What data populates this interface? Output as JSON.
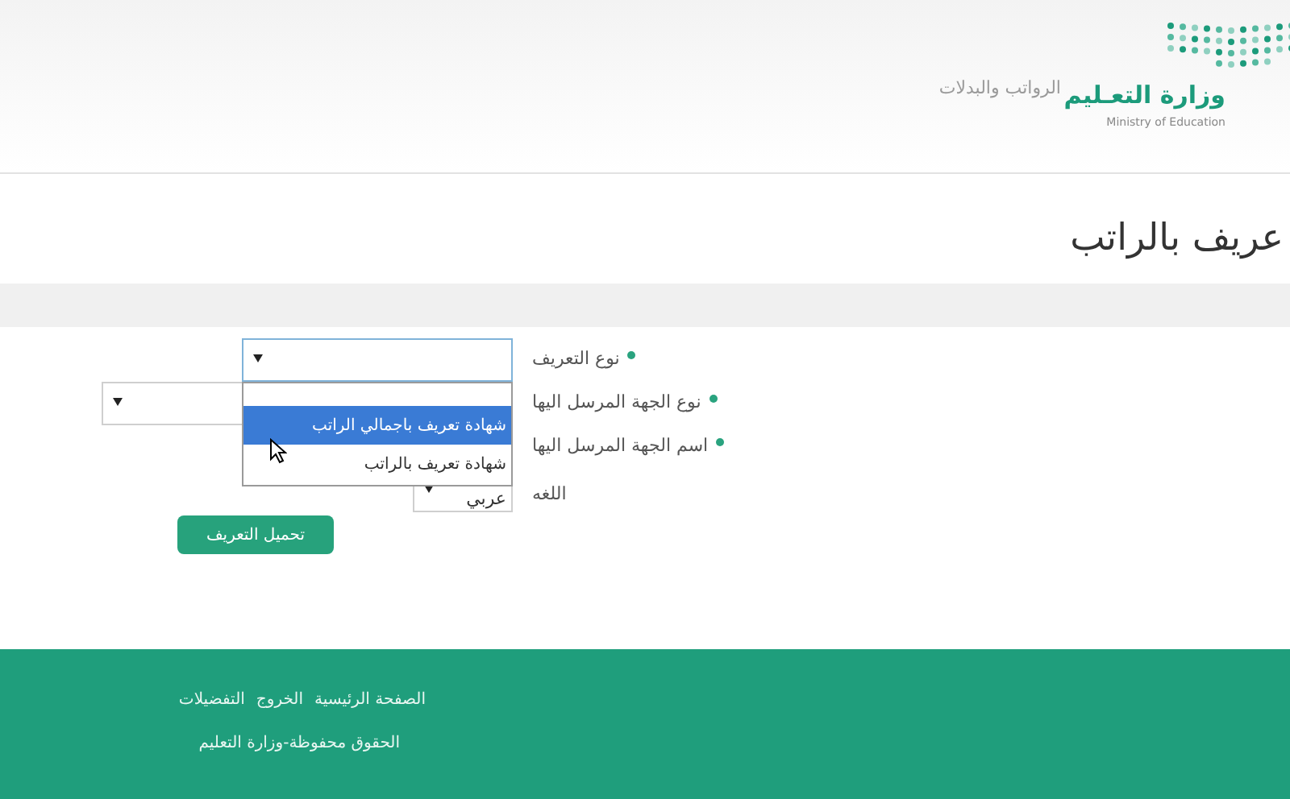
{
  "header": {
    "logo_text": "وزارة التعـليم",
    "logo_subtitle": "Ministry of Education",
    "nav_link": "الرواتب والبدلات"
  },
  "page_title": "عريف بالراتب",
  "form": {
    "fields": [
      {
        "label": "نوع التعريف",
        "required": true,
        "kind": "select",
        "expanded": true
      },
      {
        "label": "نوع الجهة المرسل اليها",
        "required": true,
        "kind": "select",
        "expanded": false
      },
      {
        "label": "اسم الجهة المرسل اليها",
        "required": true
      },
      {
        "label": "اللغه",
        "required": false,
        "kind": "select",
        "expanded": false,
        "value": "عربي"
      }
    ],
    "dropdown_options": [
      {
        "label": "شهادة تعريف باجمالي الراتب",
        "selected": true
      },
      {
        "label": "شهادة تعريف بالراتب",
        "selected": false
      }
    ],
    "submit_button": "تحميل التعريف"
  },
  "footer": {
    "links": [
      "الصفحة الرئيسية",
      "الخروج",
      "التفضيلات"
    ],
    "copyright": "الحقوق محفوظة-وزارة التعليم"
  }
}
